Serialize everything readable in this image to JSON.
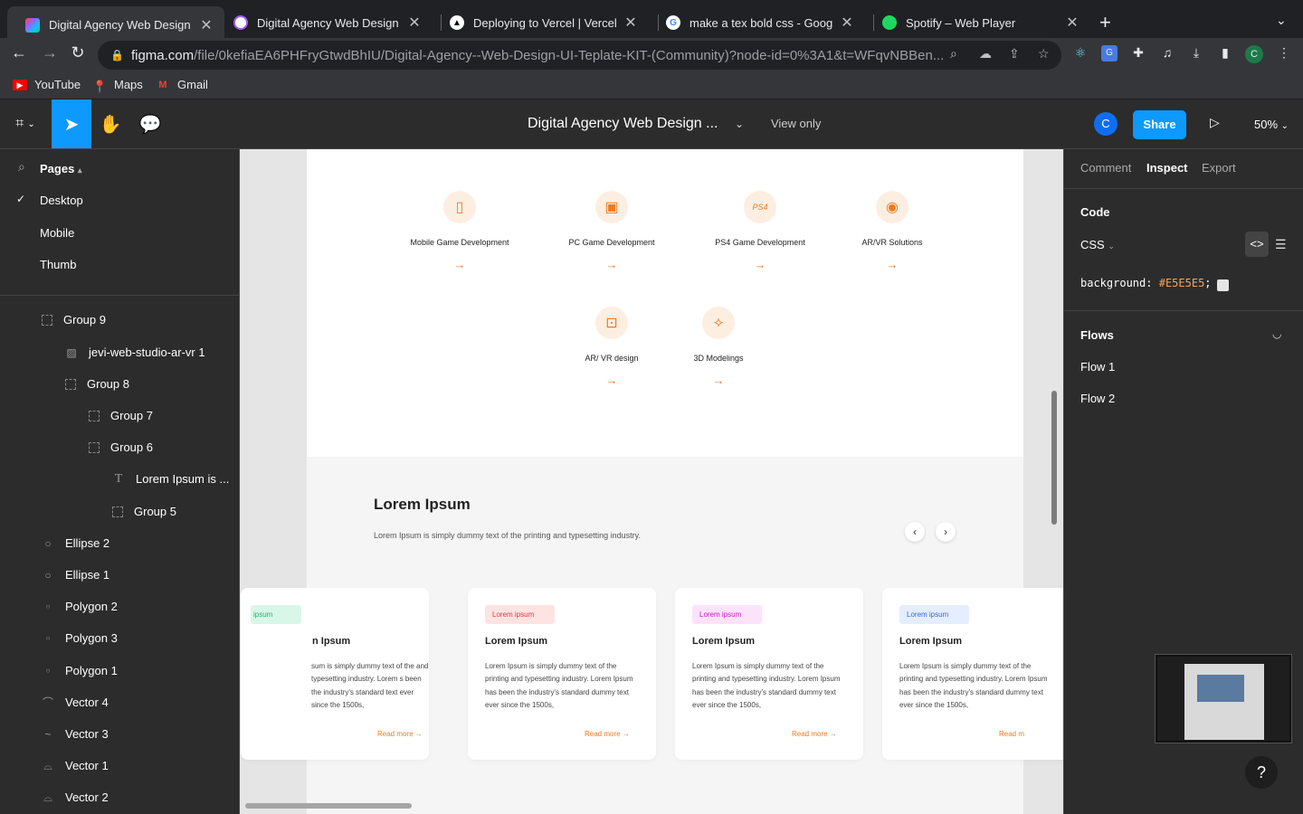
{
  "browser": {
    "tabs": [
      {
        "title": "Digital Agency Web Design UI",
        "active": true,
        "favicon": "figma-icon"
      },
      {
        "title": "Digital Agency Web Design UI",
        "active": false,
        "favicon": "figma-icon"
      },
      {
        "title": "Deploying to Vercel | Vercel Do",
        "active": false,
        "favicon": "vercel-icon"
      },
      {
        "title": "make a tex bold css - Google S",
        "active": false,
        "favicon": "google-icon"
      },
      {
        "title": "Spotify – Web Player",
        "active": false,
        "favicon": "spotify-icon"
      }
    ],
    "url_domain": "figma.com",
    "url_path": "/file/0kefiaEA6PHFryGtwdBhIU/Digital-Agency--Web-Design-UI-Teplate-KIT-(Community)?node-id=0%3A1&t=WFqvNBBen...",
    "bookmarks": [
      "YouTube",
      "Maps",
      "Gmail"
    ],
    "profile_initial": "C"
  },
  "figma": {
    "file_title": "Digital Agency Web Design ...",
    "view_mode": "View only",
    "avatar_initial": "C",
    "share_label": "Share",
    "zoom": "50%"
  },
  "left_panel": {
    "pages_label": "Pages",
    "pages": [
      "Desktop",
      "Mobile",
      "Thumb"
    ],
    "selected_page": "Desktop",
    "layers": [
      {
        "name": "Group 9",
        "type": "group",
        "indent": 0
      },
      {
        "name": "jevi-web-studio-ar-vr 1",
        "type": "image",
        "indent": 1
      },
      {
        "name": "Group 8",
        "type": "group",
        "indent": 1
      },
      {
        "name": "Group 7",
        "type": "group",
        "indent": 2
      },
      {
        "name": "Group 6",
        "type": "group",
        "indent": 2
      },
      {
        "name": "Lorem Ipsum is ...",
        "type": "text",
        "indent": 3
      },
      {
        "name": "Group 5",
        "type": "group",
        "indent": 3
      },
      {
        "name": "Ellipse 2",
        "type": "ellipse",
        "indent": 0
      },
      {
        "name": "Ellipse 1",
        "type": "ellipse",
        "indent": 0
      },
      {
        "name": "Polygon 2",
        "type": "polygon",
        "indent": 0
      },
      {
        "name": "Polygon 3",
        "type": "polygon",
        "indent": 0
      },
      {
        "name": "Polygon 1",
        "type": "polygon",
        "indent": 0
      },
      {
        "name": "Vector 4",
        "type": "vector",
        "indent": 0
      },
      {
        "name": "Vector 3",
        "type": "vector",
        "indent": 0
      },
      {
        "name": "Vector 1",
        "type": "vector",
        "indent": 0
      },
      {
        "name": "Vector 2",
        "type": "vector",
        "indent": 0
      }
    ]
  },
  "canvas": {
    "services": [
      {
        "name": "Mobile Game Development",
        "icon": "mobile-icon"
      },
      {
        "name": "PC Game Development",
        "icon": "pc-icon"
      },
      {
        "name": "PS4 Game Development",
        "icon": "ps4-icon"
      },
      {
        "name": "AR/VR Solutions",
        "icon": "vr-headset-icon"
      },
      {
        "name": "AR/ VR design",
        "icon": "ar-design-icon"
      },
      {
        "name": "3D Modelings",
        "icon": "cube-icon"
      }
    ],
    "section_title": "Lorem Ipsum",
    "section_desc": "Lorem Ipsum is simply dummy text of the printing and typesetting industry.",
    "cards": [
      {
        "tag": "Lorem ipsum",
        "tag_visible": "ipsum",
        "tag_bg": "#d9f7e8",
        "tag_color": "#1fb26b",
        "title": "Lorem Ipsum",
        "title_visible": "n Ipsum",
        "desc": "sum is simply dummy text of the and typesetting industry. Lorem s been the industry's standard text ever since the 1500s,",
        "read_more": "Read more"
      },
      {
        "tag": "Lorem ipsum",
        "tag_bg": "#ffe3e3",
        "tag_color": "#e53935",
        "title": "Lorem Ipsum",
        "desc": "Lorem Ipsum is simply dummy text of the printing and typesetting industry. Lorem Ipsum has been the industry's standard dummy text ever since the 1500s,",
        "read_more": "Read more"
      },
      {
        "tag": "Lorem ipsum",
        "tag_bg": "#fce3fb",
        "tag_color": "#c21cc0",
        "title": "Lorem Ipsum",
        "desc": "Lorem Ipsum is simply dummy text of the printing and typesetting industry. Lorem Ipsum has been the industry's standard dummy text ever since the 1500s,",
        "read_more": "Read more"
      },
      {
        "tag": "Lorem ipsum",
        "tag_bg": "#e5eefe",
        "tag_color": "#2e6bdf",
        "title": "Lorem Ipsum",
        "desc": "Lorem Ipsum is simply dummy text of the printing and typesetting industry. Lorem Ipsum has been the industry's standard dummy text ever since the 1500s,",
        "read_more": "Read m"
      }
    ],
    "accent_color": "#f37a1f"
  },
  "right_panel": {
    "tabs": [
      "Comment",
      "Inspect",
      "Export"
    ],
    "active_tab": "Inspect",
    "code_heading": "Code",
    "code_lang": "CSS",
    "code_property": "background:",
    "code_value": "#E5E5E5",
    "code_end": ";",
    "flows_heading": "Flows",
    "flows": [
      "Flow 1",
      "Flow 2"
    ],
    "help_label": "?"
  }
}
